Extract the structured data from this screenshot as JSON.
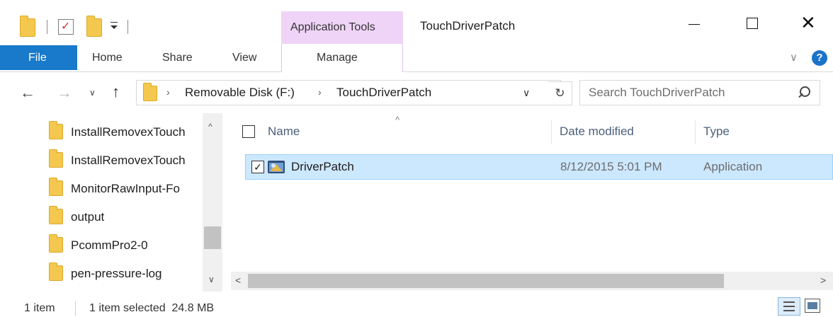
{
  "window": {
    "title": "TouchDriverPatch",
    "contextual_group": "Application Tools",
    "controls": {
      "minimize": "minimize",
      "maximize": "maximize",
      "close": "✕"
    }
  },
  "quick_access": {
    "icons": [
      "folder-icon",
      "properties-icon",
      "new-folder-icon",
      "customize-dropdown-icon"
    ]
  },
  "ribbon": {
    "tabs": [
      "File",
      "Home",
      "Share",
      "View",
      "Manage"
    ],
    "expand_label": "∨",
    "help_label": "?"
  },
  "nav": {
    "back": "←",
    "forward": "→",
    "recent": "∨",
    "up": "↑"
  },
  "address": {
    "separator": "›",
    "breadcrumbs": [
      "Removable Disk (F:)",
      "TouchDriverPatch"
    ],
    "dropdown": "∨",
    "refresh": "↻"
  },
  "search": {
    "placeholder": "Search TouchDriverPatch"
  },
  "nav_pane": {
    "items": [
      "InstallRemovexTouch",
      "InstallRemovexTouch",
      "MonitorRawInput-Fo",
      "output",
      "PcommPro2-0",
      "pen-pressure-log"
    ],
    "scroll_up": "^",
    "scroll_down": "∨"
  },
  "content": {
    "sort_indicator": "^",
    "columns": [
      "Name",
      "Date modified",
      "Type"
    ],
    "files": [
      {
        "name": "DriverPatch",
        "date_modified": "8/12/2015 5:01 PM",
        "type": "Application",
        "selected": true,
        "checked": "✓",
        "icon": "application-icon"
      }
    ],
    "scroll_left": "<",
    "scroll_right": ">"
  },
  "status": {
    "item_count": "1 item",
    "selection": "1 item selected  24.8 MB"
  },
  "colors": {
    "file_tab": "#1979ca",
    "contextual_tab": "#efd4f7",
    "selection_fill": "#cce8ff",
    "selection_border": "#99d1ff",
    "folder": "#f4c84e"
  }
}
